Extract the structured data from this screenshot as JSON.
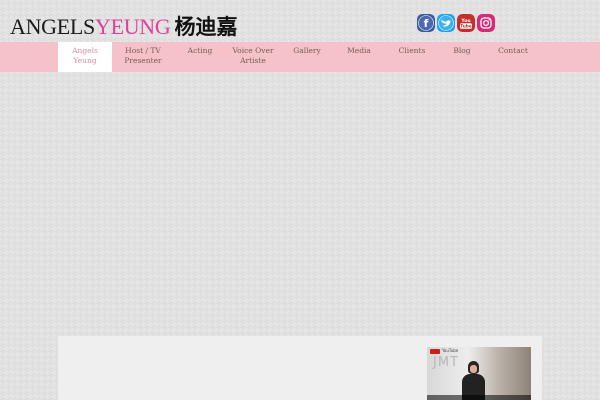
{
  "logo": {
    "part1": "ANGELS",
    "part2": "YEUNG",
    "part3": "杨迪嘉"
  },
  "social": [
    {
      "name": "facebook",
      "glyph": "f",
      "color": "#3b5998"
    },
    {
      "name": "twitter",
      "glyph": "t",
      "color": "#1da1f2"
    },
    {
      "name": "youtube",
      "glyph": "You Tube",
      "color": "#c4302b"
    },
    {
      "name": "instagram",
      "glyph": "◎",
      "color": "#d62976"
    }
  ],
  "nav": {
    "items": [
      {
        "line1": "Angels",
        "line2": "Yeung",
        "active": true
      },
      {
        "line1": "Host / TV",
        "line2": "Presenter"
      },
      {
        "line1": "Acting",
        "line2": ""
      },
      {
        "line1": "Voice Over",
        "line2": "Artiste"
      },
      {
        "line1": "Gallery",
        "line2": ""
      },
      {
        "line1": "Media",
        "line2": ""
      },
      {
        "line1": "Clients",
        "line2": ""
      },
      {
        "line1": "Blog",
        "line2": ""
      },
      {
        "line1": "Contact",
        "line2": ""
      }
    ]
  },
  "video": {
    "channel_label": "JMT",
    "brand": "YouTube"
  },
  "colors": {
    "nav_bg": "#f4c2c8",
    "accent_pink": "#e0409a",
    "page_bg": "#e2e2e2"
  }
}
